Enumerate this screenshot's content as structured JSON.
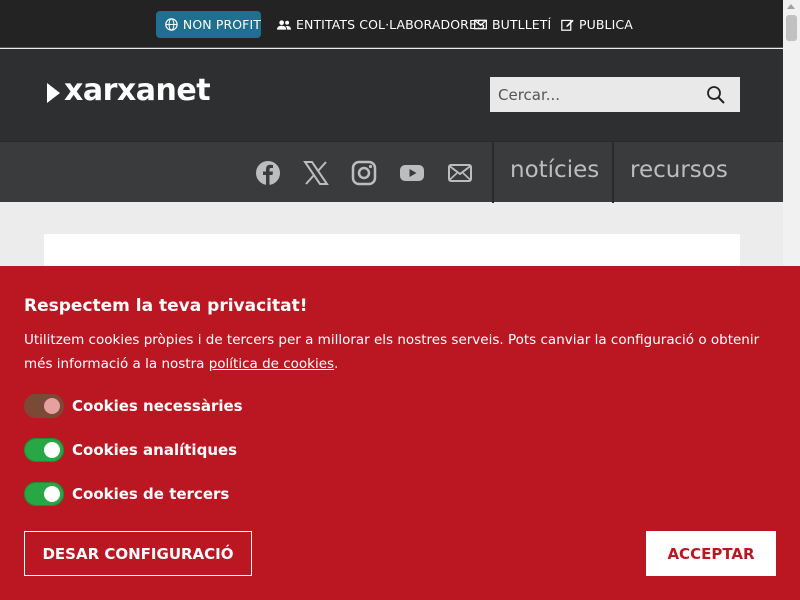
{
  "topbar": {
    "nonprofit": {
      "label": "NON PROFIT",
      "icon": "globe-icon"
    },
    "entitats": {
      "label": "ENTITATS COL·LABORADORES",
      "icon": "users-icon"
    },
    "butlleti": {
      "label": "BUTLLETÍ",
      "icon": "envelope-icon"
    },
    "publica": {
      "label": "PUBLICA",
      "icon": "edit-icon"
    },
    "accent_color": "#1f6f90"
  },
  "header": {
    "logo_text": "xarxanet",
    "search": {
      "placeholder": "Cercar...",
      "icon": "search-icon"
    }
  },
  "navbar": {
    "social_icons": [
      "facebook-icon",
      "x-twitter-icon",
      "instagram-icon",
      "youtube-icon",
      "mail-icon"
    ],
    "links": [
      {
        "label": "notícies"
      },
      {
        "label": "recursos"
      }
    ]
  },
  "cookie_banner": {
    "background_color": "#bb1722",
    "title": "Respectem la teva privacitat!",
    "text_before_link": "Utilitzem cookies pròpies i de tercers per a millorar els nostres serveis. Pots canviar la configuració o obtenir més informació a la nostra ",
    "link_text": "política de cookies",
    "text_after_link": ".",
    "options": [
      {
        "label": "Cookies necessàries",
        "enabled": true,
        "locked": true
      },
      {
        "label": "Cookies analítiques",
        "enabled": true,
        "locked": false
      },
      {
        "label": "Cookies de tercers",
        "enabled": true,
        "locked": false
      }
    ],
    "save_label": "DESAR CONFIGURACIÓ",
    "accept_label": "ACCEPTAR"
  }
}
